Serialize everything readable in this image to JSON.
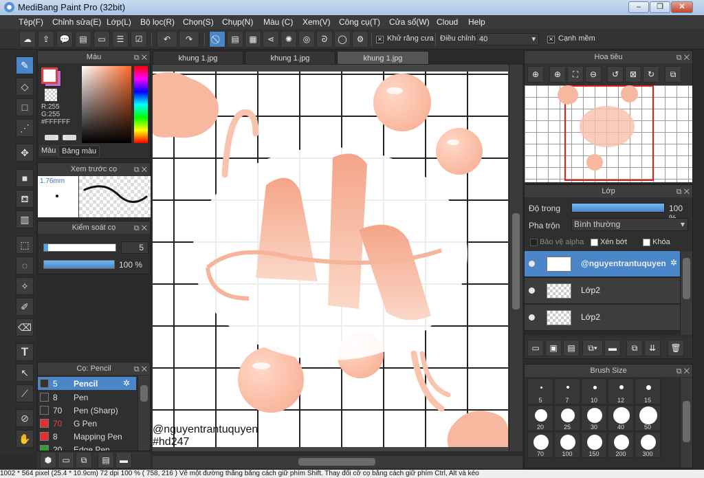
{
  "window": {
    "title": "MediBang Paint Pro (32bit)",
    "minimize": "–",
    "maximize": "❐",
    "close": "✕"
  },
  "menu": [
    "Tệp(F)",
    "Chỉnh sửa(E)",
    "Lớp(L)",
    "Bộ lọc(R)",
    "Chọn(S)",
    "Chụp(N)",
    "Màu (C)",
    "Xem(V)",
    "Công cụ(T)",
    "Cửa sổ(W)",
    "Cloud",
    "Help"
  ],
  "toolbar": {
    "antialias_label": "Khử răng cưa",
    "adjust_label": "Điều chỉnh",
    "adjust_value": "40",
    "soften_label": "Cạnh mềm",
    "check_on": "✕",
    "icons": [
      "cloud-icon",
      "export-icon",
      "comment-icon",
      "chat-icon",
      "document-icon",
      "text-grid-icon",
      "checklist-icon"
    ],
    "history": [
      "↶",
      "↷"
    ],
    "snaps": [
      "⃠",
      "▤",
      "▦",
      "⋖",
      "✺",
      "◎",
      "ᘐ",
      "◯",
      "⚙"
    ]
  },
  "color_panel": {
    "title": "Màu",
    "rgb_r": "R:255",
    "rgb_g": "G:255",
    "hex": "#FFFFFF",
    "tab_color": "Màu",
    "tab_palette": "Bảng màu",
    "primary": "#e04040",
    "secondary": "#c070d0"
  },
  "brush_preview": {
    "title": "Xem trước cọ",
    "size": "1.76mm"
  },
  "brush_control": {
    "title": "Kiểm soát cọ",
    "size_value": "5",
    "opacity": "100 %"
  },
  "brush_list": {
    "title": "Cọ: Pencil",
    "items": [
      {
        "size": "5",
        "name": "Pencil",
        "color": "#333",
        "sel": true
      },
      {
        "size": "8",
        "name": "Pen",
        "color": "#333"
      },
      {
        "size": "70",
        "name": "Pen (Sharp)",
        "color": "#333"
      },
      {
        "size": "70",
        "name": "G Pen",
        "color": "#e03030"
      },
      {
        "size": "8",
        "name": "Mapping Pen",
        "color": "#e03030"
      },
      {
        "size": "20",
        "name": "Edge Pen",
        "color": "#30a030"
      }
    ]
  },
  "tabs": [
    "khung 1.jpg",
    "khung 1.jpg",
    "khung 1.jpg"
  ],
  "watermark": {
    "line1": "@nguyentrantuquyen",
    "line2": "#hd247"
  },
  "navigator": {
    "title": "Hoa tiêu"
  },
  "layers": {
    "title": "Lớp",
    "opacity_label": "Độ trong",
    "opacity_value": "100 %",
    "blend_label": "Pha trộn",
    "blend_value": "Bình thường",
    "protect_alpha": "Bảo vệ alpha",
    "clip": "Xén bớt",
    "lock": "Khóa",
    "items": [
      {
        "name": "@nguyentrantuquyen",
        "selected": true
      },
      {
        "name": "Lớp2",
        "selected": false
      },
      {
        "name": "Lớp2",
        "selected": false
      }
    ]
  },
  "brush_size": {
    "title": "Brush Size",
    "values": [
      "5",
      "7",
      "10",
      "12",
      "15",
      "20",
      "25",
      "30",
      "40",
      "50",
      "70",
      "100",
      "150",
      "200",
      "300"
    ]
  },
  "status": "1002 * 564 pixel (25.4 * 10.9cm) 72 dpi 100 % ( 758, 216 ) Vẽ một đường thẳng bằng cách giữ phím Shift. Thay đổi cỡ cọ bằng cách giữ phím Ctrl, Alt và kéo"
}
